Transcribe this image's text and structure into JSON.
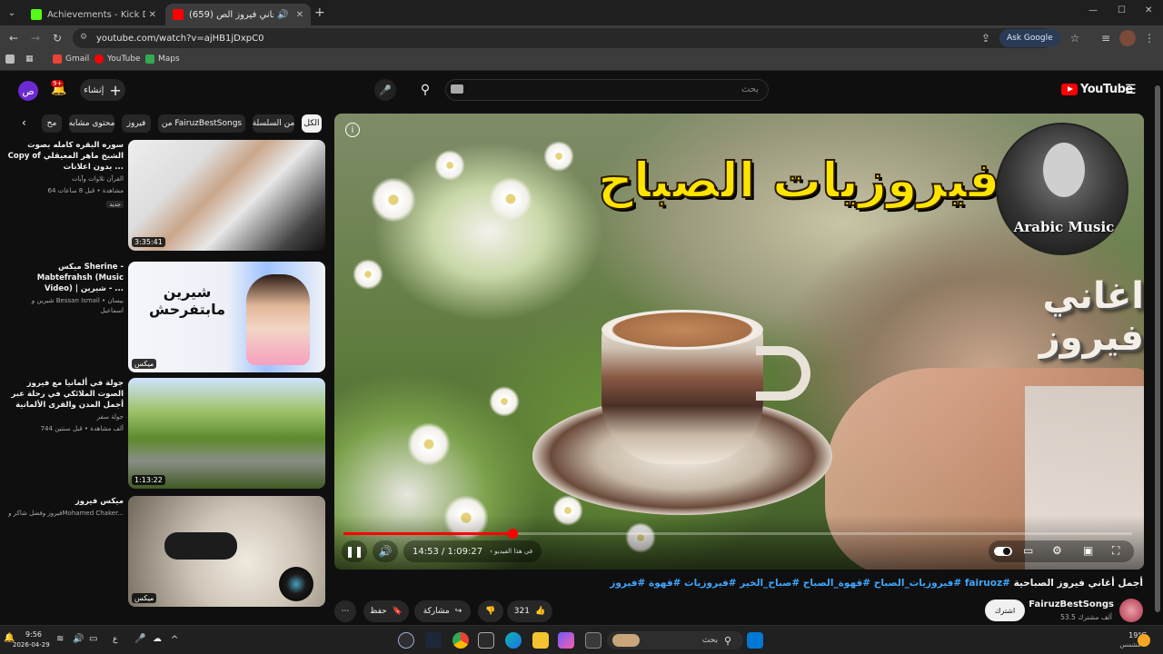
{
  "browser": {
    "tabs": [
      {
        "title": "Achievements - Kick Dashboard",
        "active": false,
        "favicon_color": "#53fc18"
      },
      {
        "title": "(659) أجمل أغاني فيروز الص",
        "active": true,
        "favicon_color": "#ff0000"
      }
    ],
    "url": "youtube.com/watch?v=ajHB1jDxpC0",
    "ask_google": "Ask Google",
    "bookmarks": [
      "Gmail",
      "YouTube",
      "Maps"
    ]
  },
  "yt_header": {
    "avatar_letter": "ص",
    "notifications": "9+",
    "create_label": "إنشاء",
    "search_placeholder": "بحث",
    "logo_text": "YouTube"
  },
  "chips": [
    "الكل",
    "من السلسلة",
    "من FairuzBestSongs",
    "فيروز",
    "محتوى مشابه",
    "مح"
  ],
  "recommendations": [
    {
      "title": "سوره البقره كامله بصوت Copy of الشيخ ماهر المعيقلي بدون اعلانات ...",
      "channel": "القرآن تلاوات وآيات",
      "meta": "64 مشاهدة • قبل 8 ساعات",
      "badge": "جديد",
      "duration": "3:35:41"
    },
    {
      "title": "ميكس Sherine - Mabtefrahsh (Music Video) | شيرين - ...",
      "channel": "شيرين و Bessan Ismail • بيسان اسماعيل",
      "meta": "",
      "badge": "",
      "duration": "ميكس"
    },
    {
      "title": "جولة في ألمانيا مع فيروز الصوت الملائكي في رحلة عبر أجمل المدن والقرى الألمانية",
      "channel": "جولة سفر",
      "meta": "744 ألف مشاهدة • قبل سنتين",
      "badge": "",
      "duration": "1:13:22"
    },
    {
      "title": "ميكس فيروز",
      "channel": "فيروز وفضل شاكر وMohamed Chaker...",
      "meta": "",
      "badge": "",
      "duration": "ميكس"
    }
  ],
  "player": {
    "art_title": "فيروزيات الصباح",
    "art_subtitle": "اغاني فيروز",
    "badge_text": "Arabic Music",
    "time": "14:53 / 1:09:27",
    "chapter": "في هذا الفيديو",
    "progress": 0.214
  },
  "video": {
    "title": "أجمل أغاني فيروز الصباحية",
    "tags": "#fairuoz #فيروزيات_الصباح #قهوة_الصباح #صباح_الخير #فيروزيات #قهوة #فيروز",
    "channel": "FairuzBestSongs",
    "subscribers": "53.5 ألف مشترك",
    "subscribe_label": "اشترك",
    "likes": "321",
    "share_label": "مشاركة",
    "save_label": "حفظ"
  },
  "taskbar": {
    "time": "9:56",
    "date": "2026-04-29",
    "search_placeholder": "بحث",
    "weather_temp": "19°C",
    "weather_desc": "مشمس",
    "lang": "ع"
  }
}
